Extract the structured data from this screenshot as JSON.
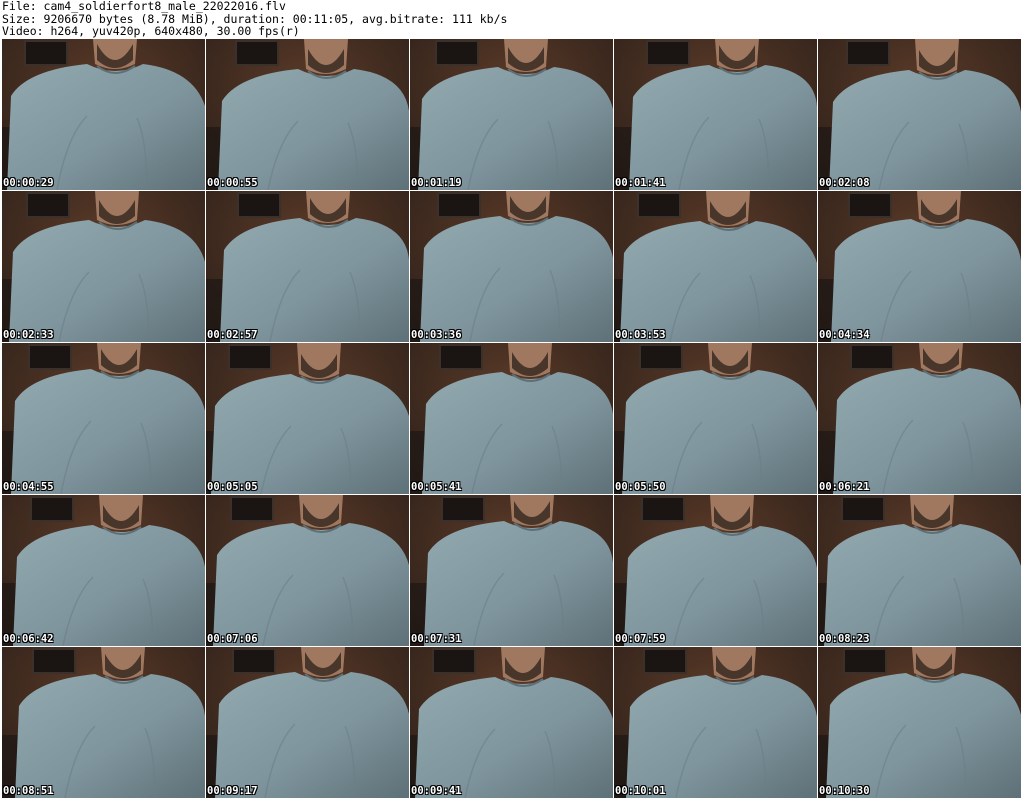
{
  "header": {
    "file_line": "File: cam4_soldierfort8_male_22022016.flv",
    "size_line": "Size: 9206670 bytes (8.78 MiB), duration: 00:11:05, avg.bitrate: 111 kb/s",
    "video_line": "Video: h264, yuv420p, 640x480, 30.00 fps(r)"
  },
  "colors": {
    "background": "#ffffff",
    "room_dark": "#2a1e18",
    "wall_warm": "#5a3a28",
    "shirt": "#7f959d",
    "skin": "#a07860",
    "beard": "#3a2a22",
    "timestamp_text": "#ffffff"
  },
  "thumbnails": [
    {
      "timestamp": "00:00:29"
    },
    {
      "timestamp": "00:00:55"
    },
    {
      "timestamp": "00:01:19"
    },
    {
      "timestamp": "00:01:41"
    },
    {
      "timestamp": "00:02:08"
    },
    {
      "timestamp": "00:02:33"
    },
    {
      "timestamp": "00:02:57"
    },
    {
      "timestamp": "00:03:36"
    },
    {
      "timestamp": "00:03:53"
    },
    {
      "timestamp": "00:04:34"
    },
    {
      "timestamp": "00:04:55"
    },
    {
      "timestamp": "00:05:05"
    },
    {
      "timestamp": "00:05:41"
    },
    {
      "timestamp": "00:05:50"
    },
    {
      "timestamp": "00:06:21"
    },
    {
      "timestamp": "00:06:42"
    },
    {
      "timestamp": "00:07:06"
    },
    {
      "timestamp": "00:07:31"
    },
    {
      "timestamp": "00:07:59"
    },
    {
      "timestamp": "00:08:23"
    },
    {
      "timestamp": "00:08:51"
    },
    {
      "timestamp": "00:09:17"
    },
    {
      "timestamp": "00:09:41"
    },
    {
      "timestamp": "00:10:01"
    },
    {
      "timestamp": "00:10:30"
    }
  ]
}
